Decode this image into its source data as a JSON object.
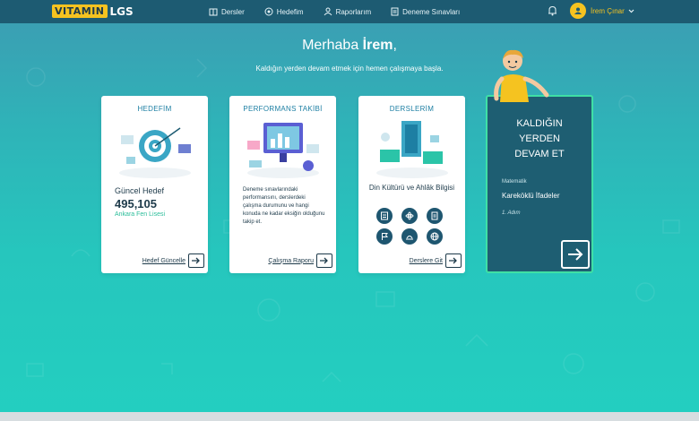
{
  "brand": {
    "vitamin": "VITAMIN",
    "lgs": "LGS"
  },
  "nav": [
    {
      "label": "Dersler",
      "icon": "book-icon"
    },
    {
      "label": "Hedefim",
      "icon": "target-icon"
    },
    {
      "label": "Raporlarım",
      "icon": "report-icon"
    },
    {
      "label": "Deneme Sınavları",
      "icon": "document-icon"
    }
  ],
  "user": {
    "name": "İrem Çınar"
  },
  "greeting": {
    "prefix": "Merhaba",
    "name": "İrem",
    "suffix": ",",
    "sub": "Kaldığın yerden devam etmek için hemen çalışmaya başla."
  },
  "cards": {
    "hedef": {
      "title": "HEDEFİM",
      "label": "Güncel Hedef",
      "value": "495,105",
      "school": "Ankara Fen Lisesi",
      "link": "Hedef Güncelle"
    },
    "perf": {
      "title": "PERFORMANS TAKİBİ",
      "desc": "Deneme sınavlarındaki performansını, derslerdeki çalışma durumunu ve hangi konuda ne kadar eksiğin olduğunu takip et.",
      "link": "Çalışma Raporu"
    },
    "ders": {
      "title": "DERSLERİM",
      "name": "Din Kültürü ve Ahlâk Bilgisi",
      "link": "Derslere Git"
    }
  },
  "resume": {
    "title_line1": "KALDIĞIN",
    "title_line2": "YERDEN",
    "title_line3": "DEVAM ET",
    "subject": "Matematik",
    "topic": "Kareköklü İfadeler",
    "step": "1. Adım"
  },
  "colors": {
    "accent": "#f5c320",
    "nav": "#1d5b72",
    "resume_border": "#3fe0a5",
    "resume_bg": "#1e5e72"
  }
}
